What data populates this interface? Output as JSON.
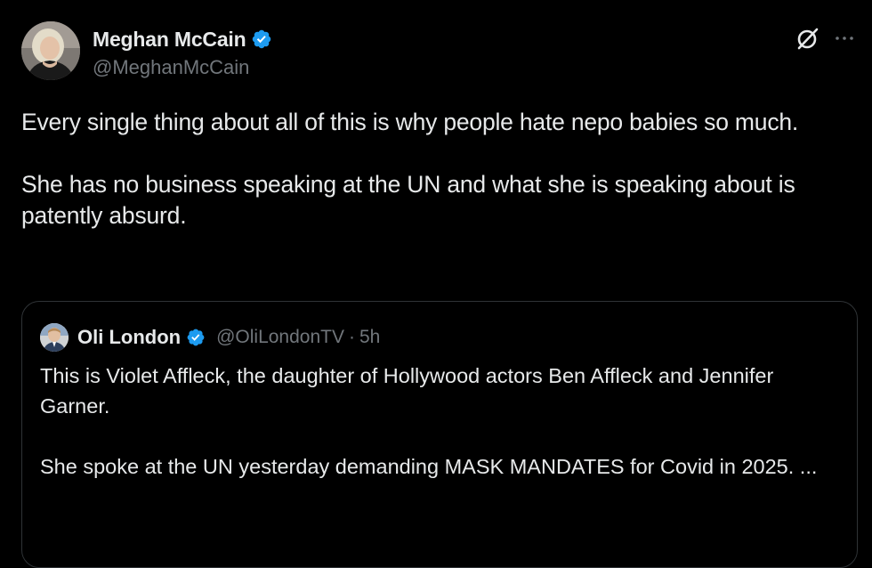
{
  "tweet": {
    "author": {
      "display_name": "Meghan McCain",
      "handle": "@MeghanMcCain",
      "verified": true,
      "verified_color": "#1d9bf0"
    },
    "paragraphs": [
      "Every single thing about all of this is why people hate nepo babies so much.",
      "She has no business speaking at the UN and what she is speaking about is patently absurd."
    ],
    "icons": {
      "grok": "grok-icon",
      "more": "more-icon"
    }
  },
  "quoted_tweet": {
    "author": {
      "display_name": "Oli London",
      "handle": "@OliLondonTV",
      "separator": "·",
      "time": "5h",
      "verified": true
    },
    "paragraphs": [
      "This is Violet Affleck, the daughter of Hollywood actors Ben Affleck and Jennifer Garner.",
      "She spoke at the UN yesterday demanding MASK MANDATES for Covid in 2025. ..."
    ]
  },
  "colors": {
    "background": "#000000",
    "text_primary": "#e7e9ea",
    "text_secondary": "#71767b",
    "border": "#2f3336",
    "verified_blue": "#1d9bf0"
  }
}
